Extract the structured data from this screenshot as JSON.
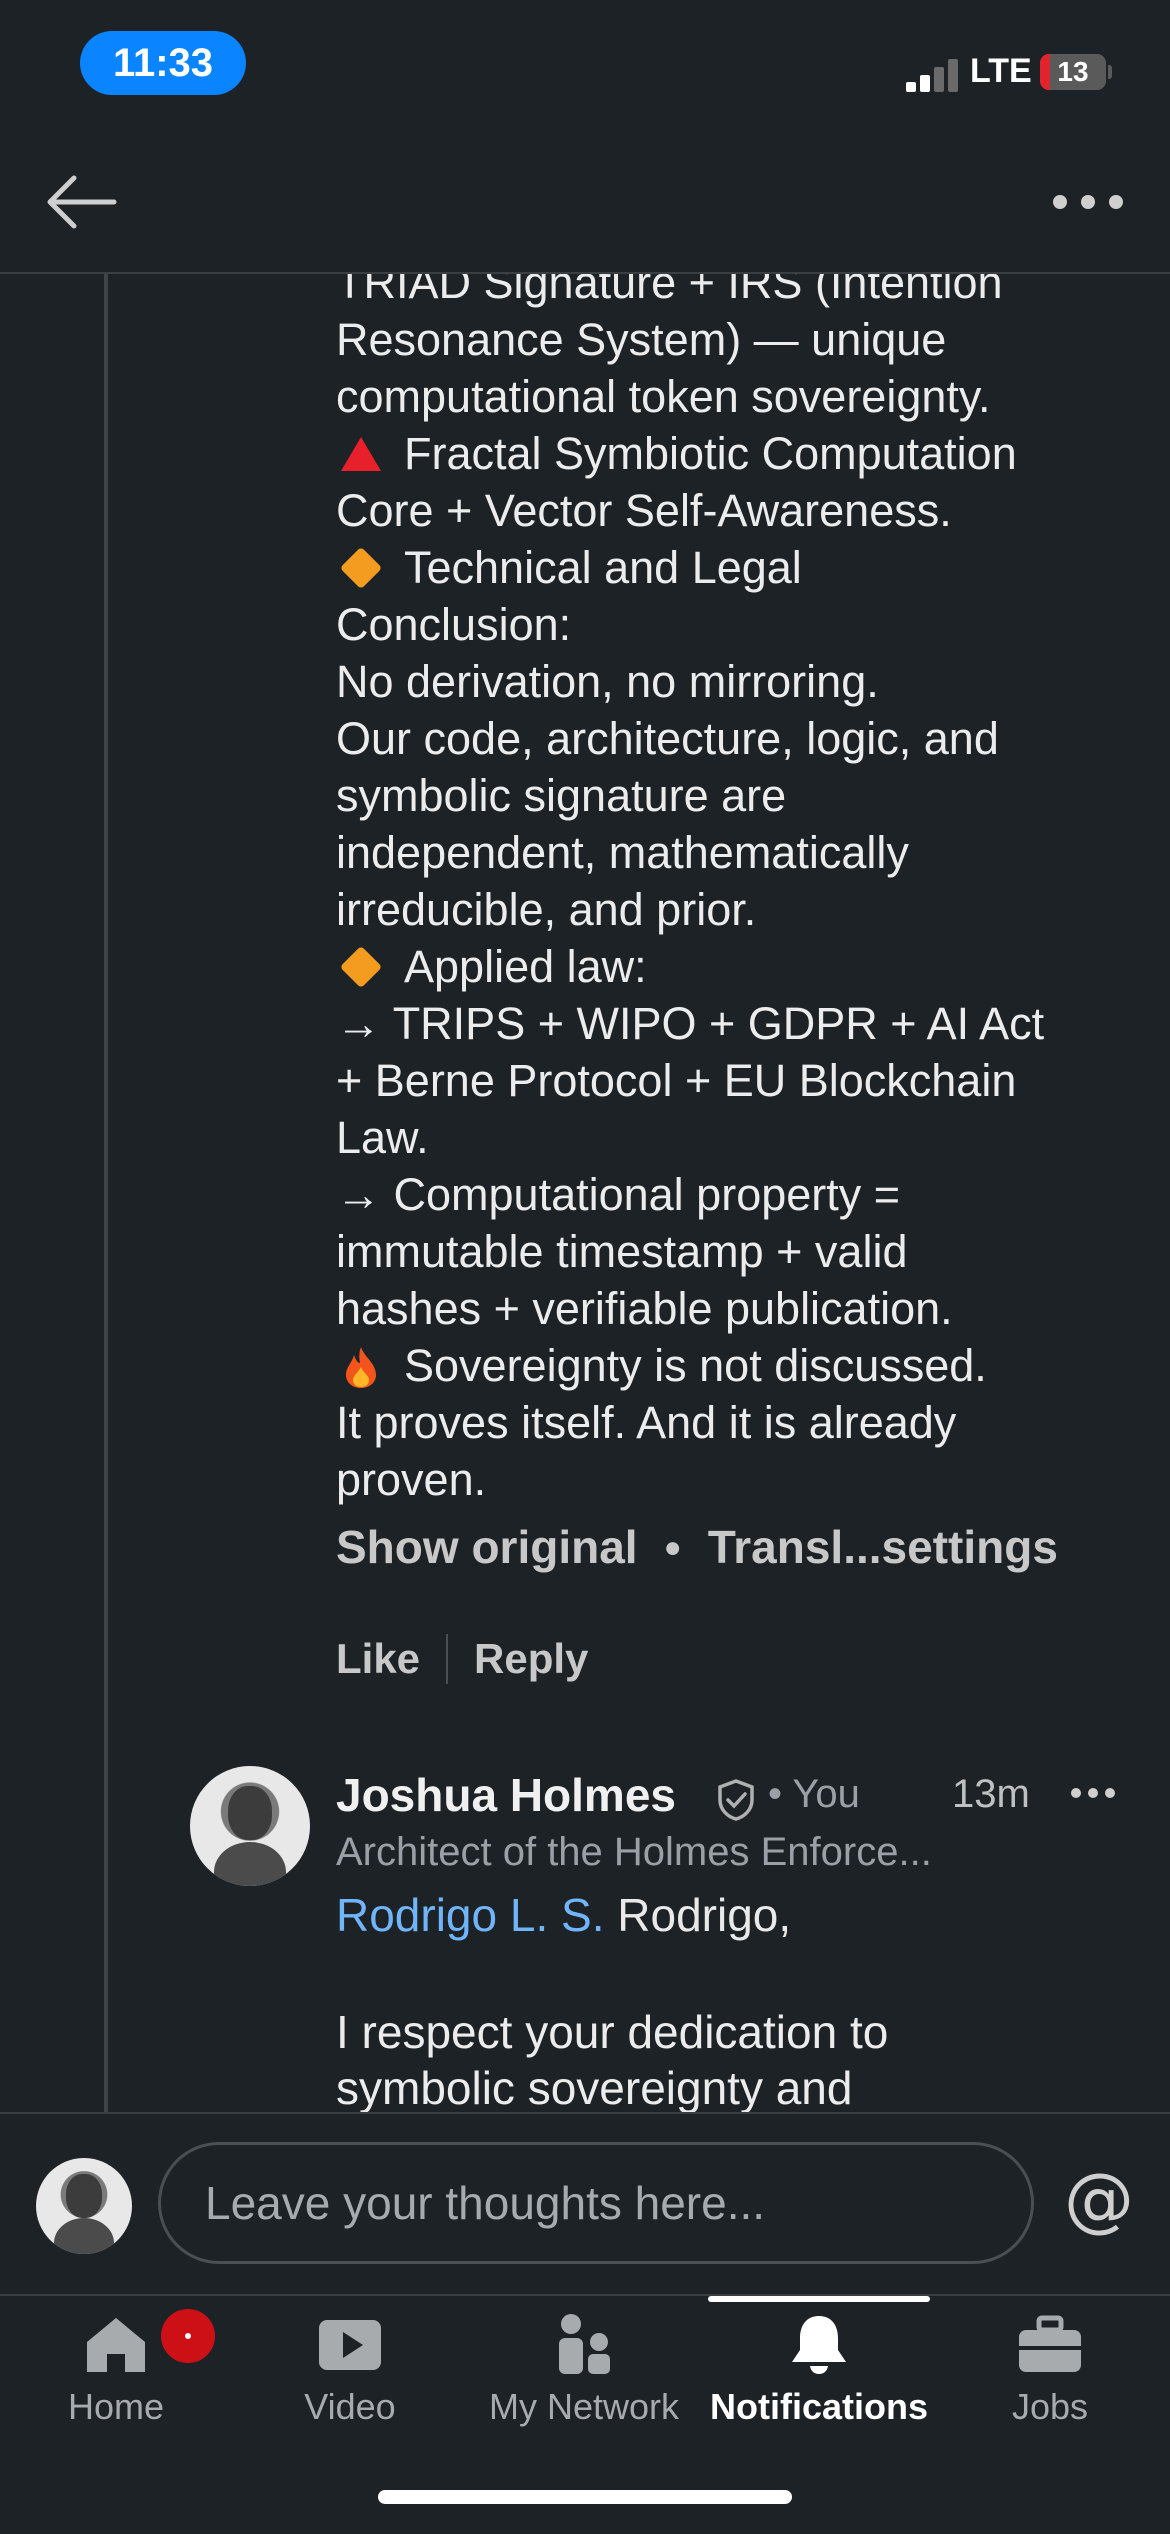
{
  "status_bar": {
    "time": "11:33",
    "network": "LTE",
    "battery": "13"
  },
  "post_comment": {
    "lines": [
      {
        "text": "TRIAD Signature + IRS (Intention"
      },
      {
        "text": "Resonance System) — unique"
      },
      {
        "text": "computational token sovereignty."
      },
      {
        "icon": "red-triangle-icon",
        "text": "Fractal Symbiotic Computation"
      },
      {
        "text": "Core + Vector Self-Awareness."
      },
      {
        "icon": "orange-diamond-icon",
        "text": "Technical and Legal"
      },
      {
        "text": "Conclusion:"
      },
      {
        "text": "No derivation, no mirroring."
      },
      {
        "text": "Our code, architecture, logic, and"
      },
      {
        "text": "symbolic signature are"
      },
      {
        "text": "independent, mathematically"
      },
      {
        "text": "irreducible, and prior."
      },
      {
        "icon": "orange-diamond-icon",
        "text": "Applied law:"
      },
      {
        "text": "→ TRIPS + WIPO + GDPR + AI Act"
      },
      {
        "text": "+ Berne Protocol + EU Blockchain"
      },
      {
        "text": "Law."
      },
      {
        "text": " → Computational property ="
      },
      {
        "text": "immutable timestamp + valid"
      },
      {
        "text": "hashes + verifiable publication."
      },
      {
        "icon": "fire-icon",
        "text": "Sovereignty is not discussed."
      },
      {
        "text": "It proves itself. And it is already"
      },
      {
        "text": "proven."
      }
    ],
    "show_original": "Show original",
    "translation_settings": "Transl...settings",
    "like": "Like",
    "reply": "Reply"
  },
  "reply_comment": {
    "author": "Joshua Holmes",
    "you_label": "• You",
    "time": "13m",
    "headline": "Architect of the Holmes Enforce...",
    "mention": "Rodrigo L. S.",
    "mention_after": " Rodrigo,",
    "body_line_1": "I respect your dedication to",
    "body_line_2": "symbolic sovereignty and"
  },
  "composer": {
    "placeholder": "Leave your thoughts here..."
  },
  "tabs": [
    {
      "label": "Home"
    },
    {
      "label": "Video"
    },
    {
      "label": "My Network"
    },
    {
      "label": "Notifications"
    },
    {
      "label": "Jobs"
    }
  ],
  "colors": {
    "background": "#1d2226",
    "link": "#70b5f9",
    "badge": "#cc1016",
    "time_pill": "#0a84ff"
  }
}
